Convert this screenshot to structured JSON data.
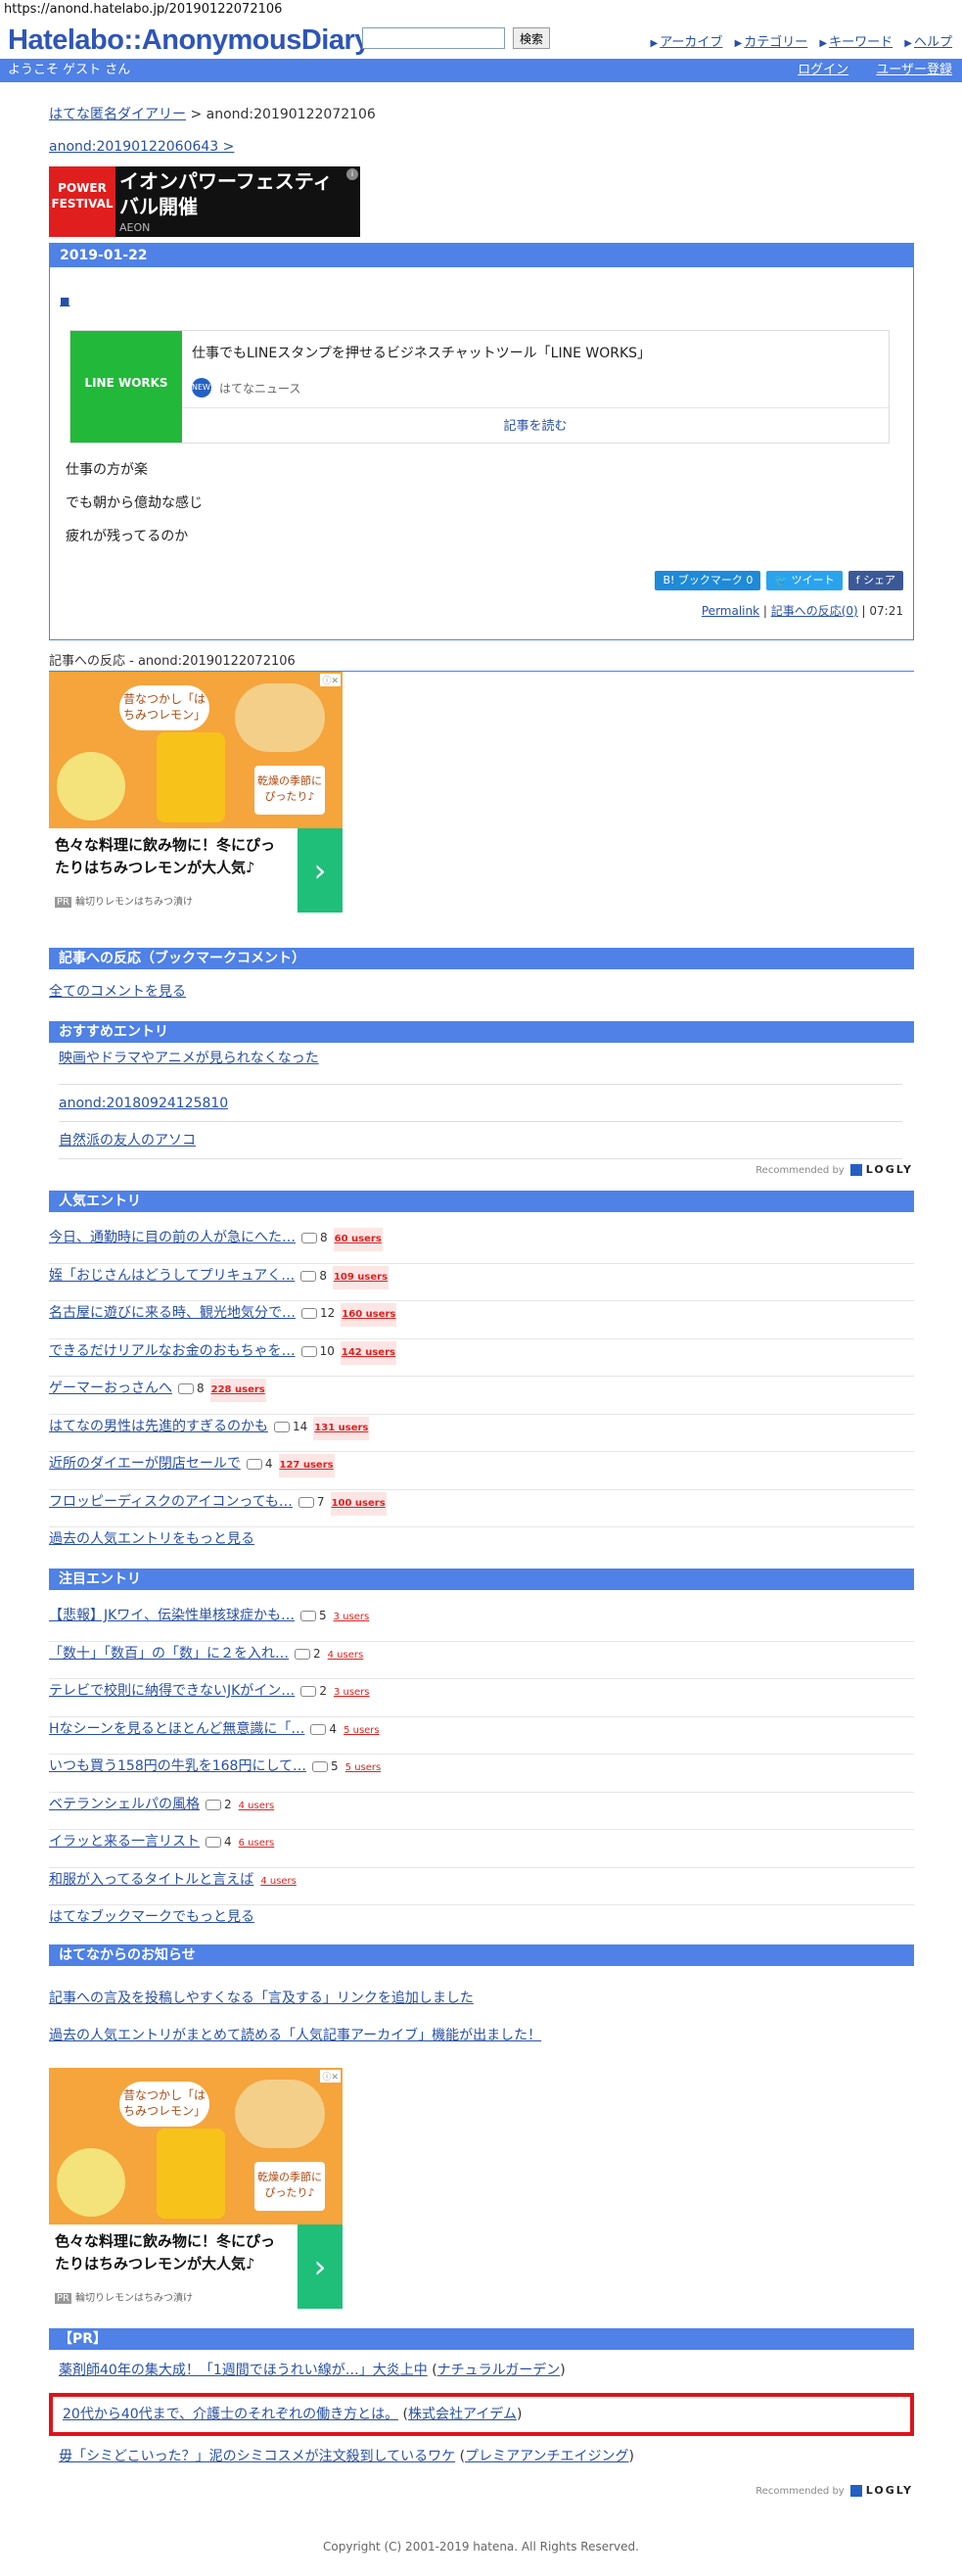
{
  "url": "https://anond.hatelabo.jp/20190122072106",
  "header": {
    "logo": "Hatelabo::AnonymousDiary",
    "search_button": "検索",
    "nav": [
      "アーカイブ",
      "カテゴリー",
      "キーワード",
      "ヘルプ"
    ]
  },
  "userbar": {
    "welcome": "ようこそ ゲスト さん",
    "login": "ログイン",
    "register": "ユーザー登録"
  },
  "breadcrumb": {
    "home": "はてな匿名ダイアリー",
    "sep": " > ",
    "current": "anond:20190122072106"
  },
  "prev_entry": "anond:20190122060643 >",
  "ad_top": {
    "thumb_text": "POWER FESTIVAL",
    "title": "イオンパワーフェスティバル開催",
    "brand": "AEON"
  },
  "diary": {
    "date": "2019-01-22",
    "anchor": "■",
    "card": {
      "thumb_text": "LINE WORKS",
      "title": "仕事でもLINEスタンプを押せるビジネスチャットツール「LINE WORKS」",
      "source": "はてなニュース",
      "read_more": "記事を読む"
    },
    "lines": [
      "仕事の方が楽",
      "でも朝から億劫な感じ",
      "疲れが残ってるのか"
    ],
    "share": {
      "bookmark": "B! ブックマーク",
      "bookmark_count": "0",
      "tweet": "ツイート",
      "facebook": "シェア"
    },
    "permalink": "Permalink",
    "reactions_link": "記事への反応(0)",
    "time": "07:21"
  },
  "reaction_heading": "記事への反応 - anond:20190122072106",
  "ad_mid": {
    "bubble": "昔なつかし「はちみつレモン」",
    "tag": "乾燥の季節にぴったり♪",
    "caption": "色々な料理に飲み物に！冬にぴったりはちみつレモンが大人気♪",
    "pr": "PR",
    "sponsor": "輪切りレモンはちみつ漬け"
  },
  "sections": {
    "bookmark_comments": "記事への反応（ブックマークコメント）",
    "all_comments": "全てのコメントを見る",
    "recommended": "おすすめエントリ",
    "popular": "人気エントリ",
    "featured": "注目エントリ",
    "notices": "はてなからのお知らせ",
    "pr": "【PR】"
  },
  "recommended": [
    "映画やドラマやアニメが見られなくなった",
    "anond:20180924125810",
    "自然派の友人のアソコ"
  ],
  "logly": {
    "label": "Recommended by",
    "brand": "LOGLY"
  },
  "popular": [
    {
      "title": "今日、通勤時に目の前の人が急にへた…",
      "comments": "8",
      "users": "60 users"
    },
    {
      "title": "姪「おじさんはどうしてプリキュアく…",
      "comments": "8",
      "users": "109 users"
    },
    {
      "title": "名古屋に遊びに来る時、観光地気分で…",
      "comments": "12",
      "users": "160 users"
    },
    {
      "title": "できるだけリアルなお金のおもちゃを…",
      "comments": "10",
      "users": "142 users"
    },
    {
      "title": "ゲーマーおっさんへ",
      "comments": "8",
      "users": "228 users"
    },
    {
      "title": "はてなの男性は先進的すぎるのかも",
      "comments": "14",
      "users": "131 users"
    },
    {
      "title": "近所のダイエーが閉店セールで",
      "comments": "4",
      "users": "127 users"
    },
    {
      "title": "フロッピーディスクのアイコンっても…",
      "comments": "7",
      "users": "100 users"
    }
  ],
  "popular_more": "過去の人気エントリをもっと見る",
  "featured": [
    {
      "title": "【悲報】JKワイ、伝染性単核球症かも…",
      "comments": "5",
      "users": "3 users"
    },
    {
      "title": "「数十」「数百」の「数」に２を入れ…",
      "comments": "2",
      "users": "4 users"
    },
    {
      "title": "テレビで校則に納得できないJKがイン…",
      "comments": "2",
      "users": "3 users"
    },
    {
      "title": "Hなシーンを見るとほとんど無意識に「…",
      "comments": "4",
      "users": "5 users"
    },
    {
      "title": "いつも買う158円の牛乳を168円にして…",
      "comments": "5",
      "users": "5 users"
    },
    {
      "title": "ベテランシェルパの風格",
      "comments": "2",
      "users": "4 users"
    },
    {
      "title": "イラッと来る一言リスト",
      "comments": "4",
      "users": "6 users"
    },
    {
      "title": "和服が入ってるタイトルと言えば",
      "comments": "",
      "users": "4 users"
    }
  ],
  "featured_more": "はてなブックマークでもっと見る",
  "notices": [
    "記事への言及を投稿しやすくなる「言及する」リンクを追加しました",
    "過去の人気エントリがまとめて読める「人気記事アーカイブ」機能が出ました！"
  ],
  "pr_items": [
    {
      "title": "薬剤師40年の集大成！「1週間でほうれい線が…」大炎上中",
      "advertiser": "ナチュラルガーデン"
    },
    {
      "title": "20代から40代まで、介護士のそれぞれの働き方とは。",
      "advertiser": "株式会社アイデム"
    },
    {
      "title": "毋「シミどこいった？」泥のシミコスメが注文殺到しているワケ",
      "advertiser": "プレミアアンチエイジング"
    }
  ],
  "footer": "Copyright (C) 2001-2019 hatena. All Rights Reserved."
}
